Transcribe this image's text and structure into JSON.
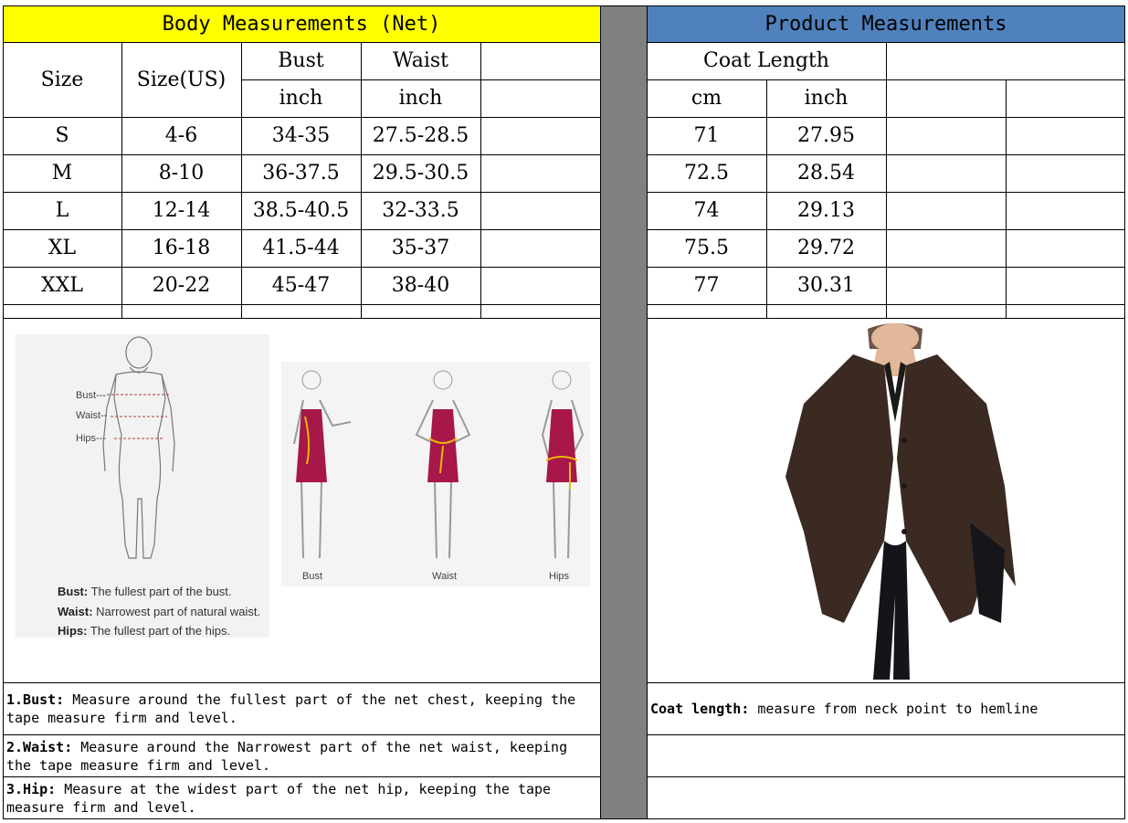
{
  "body_section": {
    "title": "Body Measurements (Net)",
    "col_size": "Size",
    "col_size_us": "Size(US)",
    "col_bust": "Bust",
    "col_waist": "Waist",
    "unit_bust": "inch",
    "unit_waist": "inch",
    "rows": [
      {
        "size": "S",
        "us": "4-6",
        "bust": "34-35",
        "waist": "27.5-28.5"
      },
      {
        "size": "M",
        "us": "8-10",
        "bust": "36-37.5",
        "waist": "29.5-30.5"
      },
      {
        "size": "L",
        "us": "12-14",
        "bust": "38.5-40.5",
        "waist": "32-33.5"
      },
      {
        "size": "XL",
        "us": "16-18",
        "bust": "41.5-44",
        "waist": "35-37"
      },
      {
        "size": "XXL",
        "us": "20-22",
        "bust": "45-47",
        "waist": "38-40"
      }
    ]
  },
  "product_section": {
    "title": "Product Measurements",
    "col_coat_length": "Coat Length",
    "unit_cm": "cm",
    "unit_inch": "inch",
    "rows": [
      {
        "cm": "71",
        "inch": "27.95"
      },
      {
        "cm": "72.5",
        "inch": "28.54"
      },
      {
        "cm": "74",
        "inch": "29.13"
      },
      {
        "cm": "75.5",
        "inch": "29.72"
      },
      {
        "cm": "77",
        "inch": "30.31"
      }
    ]
  },
  "figure_labels": {
    "bust_mark": "Bust---",
    "waist_mark": "Waist--",
    "hips_mark": "Hips---",
    "legend_bust_key": "Bust:",
    "legend_bust_text": "The fullest part of the bust.",
    "legend_waist_key": "Waist:",
    "legend_waist_text": "Narrowest part of natural waist.",
    "legend_hips_key": "Hips:",
    "legend_hips_text": "The fullest part of the hips.",
    "caption_bust": "Bust",
    "caption_waist": "Waist",
    "caption_hips": "Hips"
  },
  "notes": {
    "bust_key": "1.Bust:",
    "bust_text": " Measure around the fullest part of the net chest, keeping the tape  measure firm and level.",
    "waist_key": "2.Waist:",
    "waist_text": " Measure around the Narrowest part of the net waist, keeping the tape  measure firm and level.",
    "hip_key": "3.Hip:",
    "hip_text": " Measure at the widest part of the net hip, keeping the tape measure firm and level.",
    "coat_key": "Coat length:",
    "coat_text": " measure from neck point to hemline"
  },
  "colors": {
    "yellow_header": "#ffff00",
    "blue_header": "#4f81bd",
    "divider_gray": "#808080",
    "dress_color": "#a8174a",
    "coat_color": "#3a2a22"
  }
}
